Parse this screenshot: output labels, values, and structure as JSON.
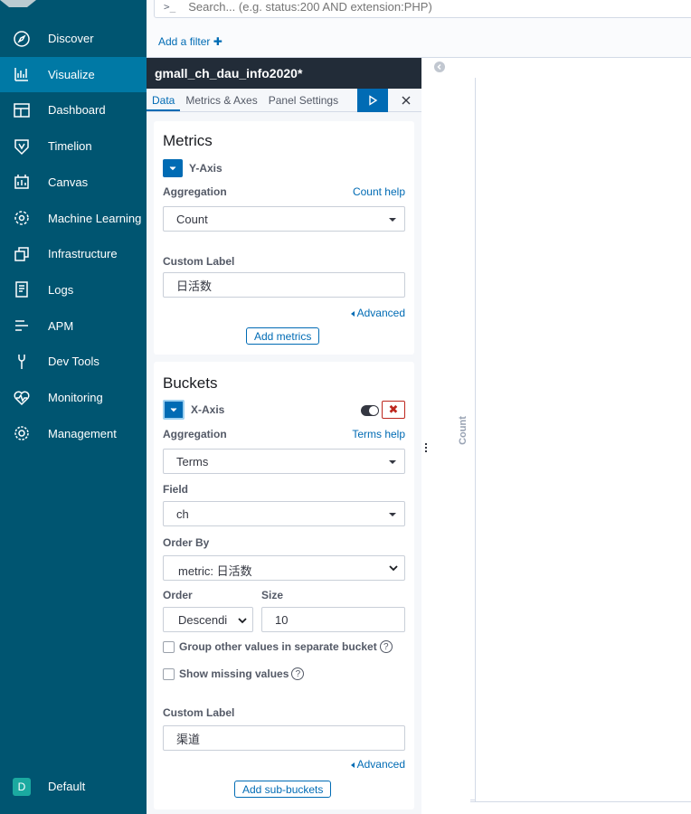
{
  "nav": {
    "items": [
      {
        "label": "Discover",
        "icon": "compass-icon",
        "active": false
      },
      {
        "label": "Visualize",
        "icon": "chart-icon",
        "active": true
      },
      {
        "label": "Dashboard",
        "icon": "dashboard-icon",
        "active": false
      },
      {
        "label": "Timelion",
        "icon": "timelion-icon",
        "active": false
      },
      {
        "label": "Canvas",
        "icon": "canvas-icon",
        "active": false
      },
      {
        "label": "Machine Learning",
        "icon": "ml-icon",
        "active": false
      },
      {
        "label": "Infrastructure",
        "icon": "infrastructure-icon",
        "active": false
      },
      {
        "label": "Logs",
        "icon": "logs-icon",
        "active": false
      },
      {
        "label": "APM",
        "icon": "apm-icon",
        "active": false
      },
      {
        "label": "Dev Tools",
        "icon": "wrench-icon",
        "active": false
      },
      {
        "label": "Monitoring",
        "icon": "heartbeat-icon",
        "active": false
      },
      {
        "label": "Management",
        "icon": "gear-icon",
        "active": false
      }
    ],
    "space": {
      "badge": "D",
      "label": "Default"
    }
  },
  "search": {
    "prompt": ">_",
    "placeholder": "Search... (e.g. status:200 AND extension:PHP)"
  },
  "filter": {
    "add_label": "Add a filter",
    "plus": "✚"
  },
  "editor": {
    "title": "gmall_ch_dau_info2020*",
    "tabs": [
      "Data",
      "Metrics & Axes",
      "Panel Settings"
    ],
    "metrics": {
      "heading": "Metrics",
      "agg_title": "Y-Axis",
      "aggregation_label": "Aggregation",
      "help_link": "Count help",
      "aggregation_value": "Count",
      "custom_label_label": "Custom Label",
      "custom_label_value": "日活数",
      "advanced": "Advanced",
      "add_button": "Add metrics"
    },
    "buckets": {
      "heading": "Buckets",
      "agg_title": "X-Axis",
      "aggregation_label": "Aggregation",
      "help_link": "Terms help",
      "aggregation_value": "Terms",
      "field_label": "Field",
      "field_value": "ch",
      "order_by_label": "Order By",
      "order_by_value": "metric: 日活数",
      "order_label": "Order",
      "order_value": "Descendi",
      "size_label": "Size",
      "size_value": "10",
      "group_other_label": "Group other values in separate bucket",
      "show_missing_label": "Show missing values",
      "help_mark": "?",
      "custom_label_label": "Custom Label",
      "custom_label_value": "渠道",
      "advanced": "Advanced",
      "add_button": "Add sub-buckets",
      "remove_glyph": "✖"
    }
  },
  "vis": {
    "y_axis_label": "Count"
  },
  "colors": {
    "sidebar": "#005571",
    "active": "#0079a5",
    "primary": "#006bb4",
    "danger": "#bd271e"
  }
}
